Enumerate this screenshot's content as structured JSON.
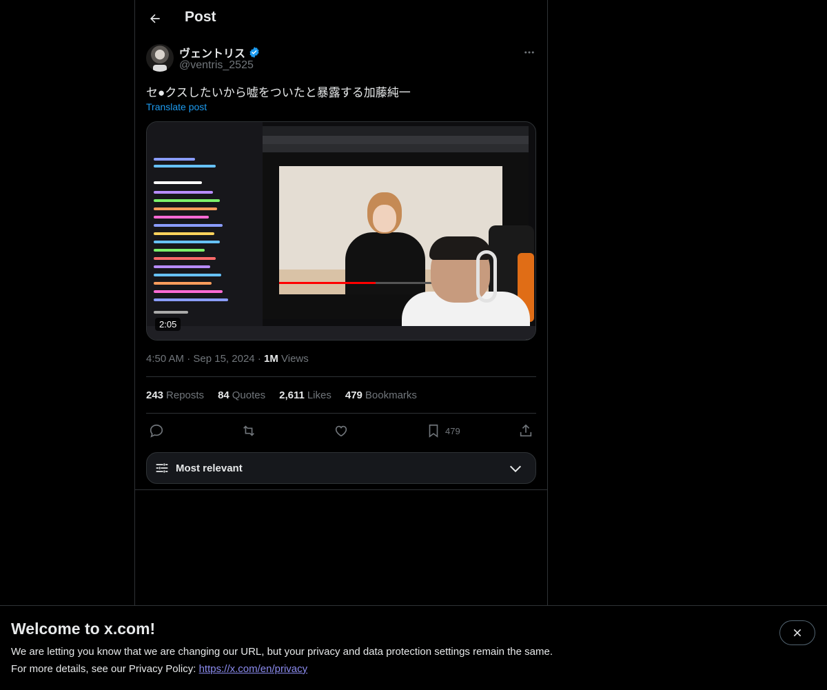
{
  "header": {
    "title": "Post"
  },
  "author": {
    "display_name": "ヴェントリス",
    "handle": "@ventris_2525",
    "verified": true
  },
  "post": {
    "text": "セ●クスしたいから嘘をついたと暴露する加藤純一",
    "translate_label": "Translate post",
    "video_duration": "2:05",
    "time": "4:50 AM",
    "date": "Sep 15, 2024",
    "views_count": "1M",
    "views_label": "Views"
  },
  "stats": [
    {
      "count": "243",
      "label": "Reposts"
    },
    {
      "count": "84",
      "label": "Quotes"
    },
    {
      "count": "2,611",
      "label": "Likes"
    },
    {
      "count": "479",
      "label": "Bookmarks"
    }
  ],
  "actions": {
    "bookmark_count": "479"
  },
  "sort": {
    "label": "Most relevant"
  },
  "banner": {
    "title": "Welcome to x.com!",
    "line1": "We are letting you know that we are changing our URL, but your privacy and data protection settings remain the same.",
    "line2_prefix": "For more details, see our Privacy Policy: ",
    "link_text": "https://x.com/en/privacy"
  },
  "colors": {
    "accent": "#1d9bf0",
    "background": "#000000",
    "text": "#e7e9ea",
    "muted": "#71767b",
    "border": "#2f3336"
  },
  "icons": [
    "arrow-left-icon",
    "verified-badge-icon",
    "more-icon",
    "reply-icon",
    "repost-icon",
    "like-icon",
    "bookmark-icon",
    "share-icon",
    "sliders-icon",
    "chevron-down-icon",
    "close-icon"
  ]
}
